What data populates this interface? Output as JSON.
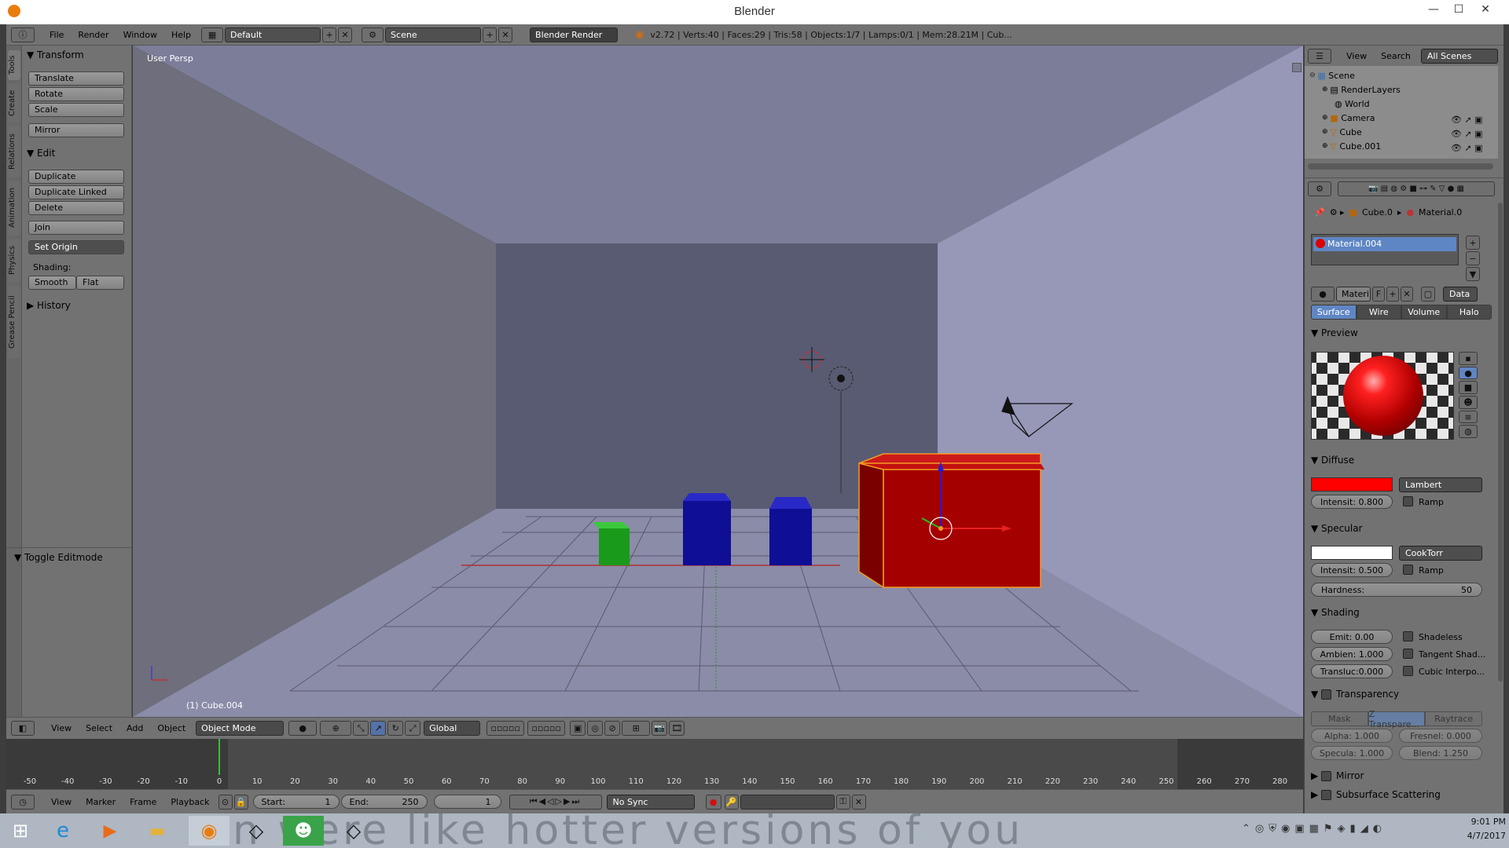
{
  "window": {
    "title": "Blender",
    "minimize_icon": "—",
    "maximize_icon": "☐",
    "close_icon": "✕"
  },
  "topbar": {
    "menus": [
      "File",
      "Render",
      "Window",
      "Help"
    ],
    "layout": "Default",
    "scene": "Scene",
    "engine": "Blender Render",
    "stats": "v2.72 | Verts:40 | Faces:29 | Tris:58 | Objects:1/7 | Lamps:0/1 | Mem:28.21M | Cub..."
  },
  "tool_shelf": {
    "tabs": [
      "Tools",
      "Create",
      "Relations",
      "Animation",
      "Physics",
      "Grease Pencil"
    ],
    "transform": {
      "header": "Transform",
      "buttons": [
        "Translate",
        "Rotate",
        "Scale",
        "Mirror"
      ]
    },
    "edit": {
      "header": "Edit",
      "buttons": [
        "Duplicate",
        "Duplicate Linked",
        "Delete",
        "Join"
      ],
      "set_origin": "Set Origin",
      "shading_label": "Shading:",
      "smooth": "Smooth",
      "flat": "Flat"
    },
    "history": "History",
    "toggle_editmode": "Toggle Editmode"
  },
  "viewport": {
    "label": "User Persp",
    "object_label": "(1) Cube.004",
    "colors": {
      "back_wall": "#595b73",
      "left_wall": "#6e6e7c",
      "right_wall": "#9798b8",
      "ceiling": "#7c7e99",
      "floor": "#8b8ca8",
      "green_cube": "#1a9a1a",
      "blue_cube": "#0f0f95",
      "red_cube": "#a50000",
      "selection": "#f39a26"
    }
  },
  "viewport_header": {
    "menus": [
      "View",
      "Select",
      "Add",
      "Object"
    ],
    "mode": "Object Mode",
    "orientation": "Global"
  },
  "timeline": {
    "ticks": [
      "-50",
      "-40",
      "-30",
      "-20",
      "-10",
      "0",
      "10",
      "20",
      "30",
      "40",
      "50",
      "60",
      "70",
      "80",
      "90",
      "100",
      "110",
      "120",
      "130",
      "140",
      "150",
      "160",
      "170",
      "180",
      "190",
      "200",
      "210",
      "220",
      "230",
      "240",
      "250",
      "260",
      "270",
      "280"
    ],
    "menus": [
      "View",
      "Marker",
      "Frame",
      "Playback"
    ],
    "start_label": "Start:",
    "start_value": "1",
    "end_label": "End:",
    "end_value": "250",
    "current_frame": "1",
    "sync": "No Sync",
    "current_frame_value": 0
  },
  "outliner": {
    "menus": [
      "View",
      "Search"
    ],
    "filter": "All Scenes",
    "items": [
      {
        "label": "Scene"
      },
      {
        "label": "RenderLayers"
      },
      {
        "label": "World"
      },
      {
        "label": "Camera"
      },
      {
        "label": "Cube"
      },
      {
        "label": "Cube.001"
      }
    ]
  },
  "properties": {
    "breadcrumb": {
      "object": "Cube.0",
      "material": "Material.0"
    },
    "material_slot": "Material.004",
    "material_name": "Materi",
    "fake_user": "F",
    "data_dropdown": "Data",
    "tabs": [
      "Surface",
      "Wire",
      "Volume",
      "Halo"
    ],
    "preview_header": "Preview",
    "diffuse": {
      "header": "Diffuse",
      "color": "#ff0000",
      "shader": "Lambert",
      "intensity_label": "Intensit:",
      "intensity": "0.800",
      "ramp": "Ramp"
    },
    "specular": {
      "header": "Specular",
      "color": "#ffffff",
      "shader": "CookTorr",
      "intensity_label": "Intensit:",
      "intensity": "0.500",
      "ramp": "Ramp",
      "hardness_label": "Hardness:",
      "hardness": "50"
    },
    "shading": {
      "header": "Shading",
      "emit": "Emit:",
      "emit_value": "0.00",
      "ambient": "Ambien: 1.000",
      "translucency": "Transluc:0.000",
      "shadeless": "Shadeless",
      "tangent": "Tangent Shad...",
      "cubic": "Cubic Interpo..."
    },
    "transparency": {
      "header": "Transparency",
      "modes": [
        "Mask",
        "Z Transpare...",
        "Raytrace"
      ],
      "alpha": "Alpha: 1.000",
      "fresnel": "Fresnel: 0.000",
      "specular": "Specula: 1.000",
      "blend": "Blend: 1.250"
    },
    "mirror": "Mirror",
    "sss": "Subsurface Scattering"
  },
  "taskbar": {
    "watermark": "en were like hotter versions of you",
    "time": "9:01 PM",
    "date": "4/7/2017"
  }
}
